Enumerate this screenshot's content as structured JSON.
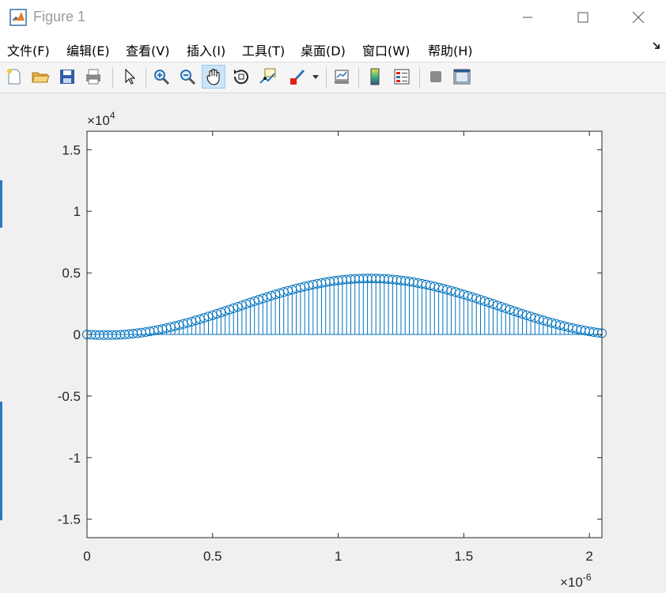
{
  "window": {
    "title": "Figure 1",
    "minimize_glyph": "—",
    "maximize_glyph": "☐",
    "close_glyph": "✕"
  },
  "menu": {
    "items": [
      "文件(F)",
      "编辑(E)",
      "查看(V)",
      "插入(I)",
      "工具(T)",
      "桌面(D)",
      "窗口(W)",
      "帮助(H)"
    ]
  },
  "toolbar": {
    "buttons": [
      "new-figure",
      "open-file",
      "save",
      "print",
      "select-arrow",
      "zoom-in",
      "zoom-out",
      "pan",
      "rotate-3d",
      "data-cursor",
      "brush",
      "link-plot",
      "colorbar",
      "legend",
      "hide-plot-tools",
      "show-plot-tools"
    ],
    "active": "pan"
  },
  "chart_data": {
    "type": "stem",
    "marker": "o",
    "color": "#0072bd",
    "x_exponent_label": "×10",
    "x_exponent": "-6",
    "y_exponent_label": "×10",
    "y_exponent": "4",
    "xlim": [
      0,
      2.05
    ],
    "ylim": [
      -1.65,
      1.65
    ],
    "xticks": [
      0,
      0.5,
      1,
      1.5,
      2
    ],
    "xtick_labels": [
      "0",
      "0.5",
      "1",
      "1.5",
      "2"
    ],
    "yticks": [
      -1.5,
      -1,
      -0.5,
      0,
      0.5,
      1,
      1.5
    ],
    "ytick_labels": [
      "-1.5",
      "-1",
      "-0.5",
      "0",
      "0.5",
      "1",
      "1.5"
    ],
    "x_start": 0,
    "x_end": 2.05,
    "n_points": 124,
    "model": {
      "offset": 0.2305,
      "amplitude": 0.2305,
      "period": 2.1,
      "phase_shift": 0.075,
      "x_unit_note": "x in 1e-6 units, y in 1e4 units"
    },
    "key_points": [
      {
        "x": 0.0,
        "y": 0.0
      },
      {
        "x": 0.25,
        "y": 0.155
      },
      {
        "x": 0.5,
        "y": 0.41
      },
      {
        "x": 0.6,
        "y": 0.455
      },
      {
        "x": 0.65,
        "y": 0.46
      },
      {
        "x": 0.75,
        "y": 0.45
      },
      {
        "x": 1.0,
        "y": 0.33
      },
      {
        "x": 1.25,
        "y": 0.15
      },
      {
        "x": 1.5,
        "y": 0.035
      },
      {
        "x": 1.7,
        "y": 0.0
      },
      {
        "x": 1.85,
        "y": 0.02
      },
      {
        "x": 2.05,
        "y": 0.1
      }
    ]
  }
}
